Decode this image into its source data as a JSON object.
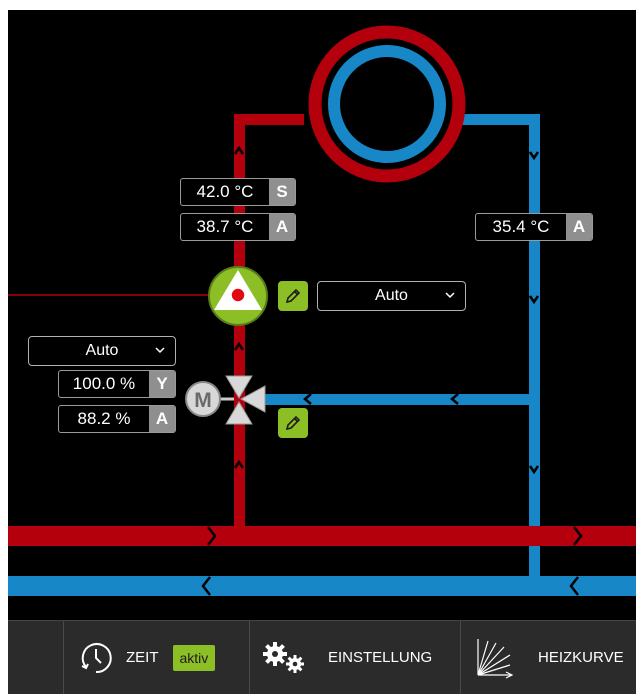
{
  "colors": {
    "supply": "#b4000d",
    "return": "#1787c7",
    "accent": "#8cbf26",
    "background": "#000000"
  },
  "supply_temp_setpoint": {
    "value": "42.0 °C",
    "tag": "S"
  },
  "supply_temp_actual": {
    "value": "38.7 °C",
    "tag": "A"
  },
  "return_temp_actual": {
    "value": "35.4 °C",
    "tag": "A"
  },
  "pump": {
    "mode": "Auto",
    "icon": "pump-icon",
    "edit_icon": "pencil-icon"
  },
  "mixer": {
    "mode": "Auto",
    "setpoint": {
      "value": "100.0 %",
      "tag": "Y"
    },
    "actual": {
      "value": "88.2 %",
      "tag": "A"
    },
    "motor_label": "M",
    "edit_icon": "pencil-icon"
  },
  "bottom_bar": {
    "zeit": {
      "label": "ZEIT",
      "badge": "aktiv",
      "icon": "clock-icon"
    },
    "einstellung": {
      "label": "EINSTELLUNG",
      "icon": "gears-icon"
    },
    "heizkurve": {
      "label": "HEIZKURVE",
      "icon": "heating-curve-icon"
    }
  }
}
